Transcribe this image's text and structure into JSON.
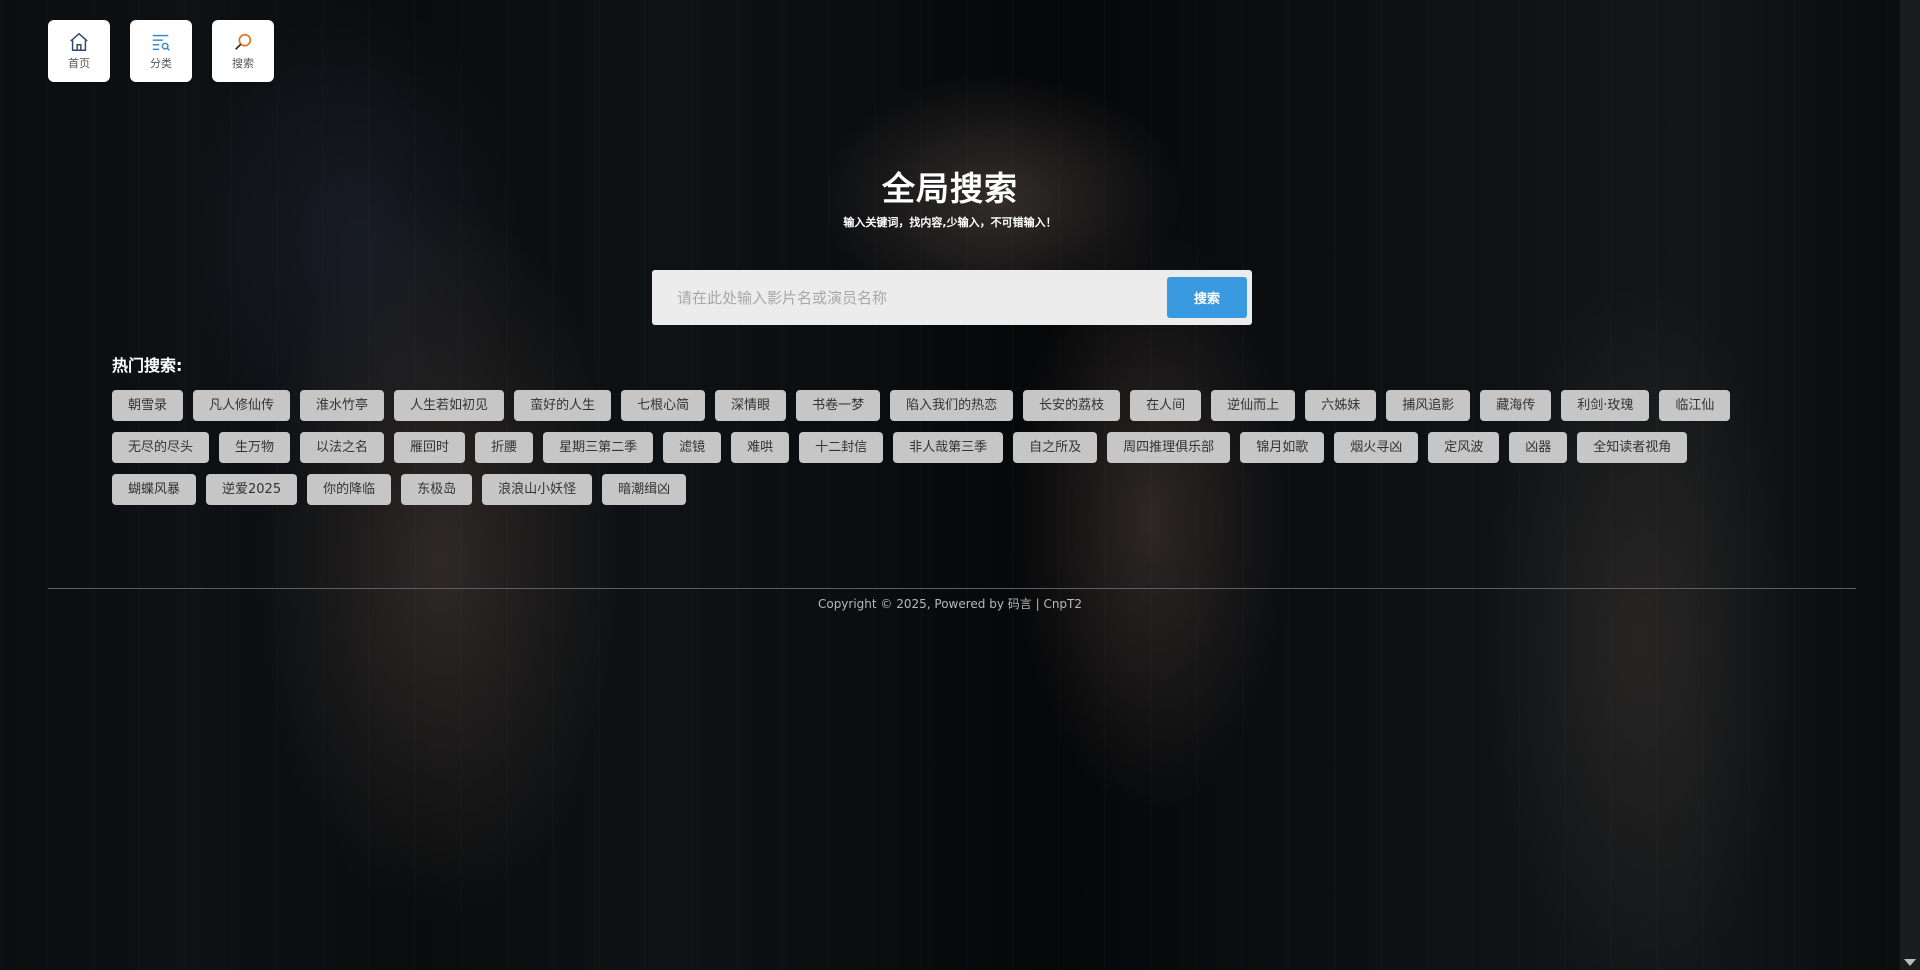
{
  "nav": [
    {
      "label": "首页",
      "icon": "home-icon"
    },
    {
      "label": "分类",
      "icon": "category-icon"
    },
    {
      "label": "搜索",
      "icon": "search-icon"
    }
  ],
  "header": {
    "title": "全局搜索",
    "subtitle": "输入关键词，找内容,少输入，不可错输入！"
  },
  "search": {
    "placeholder": "请在此处输入影片名或演员名称",
    "value": "",
    "button_label": "搜索"
  },
  "hot": {
    "label": "热门搜索:",
    "tags": [
      "朝雪录",
      "凡人修仙传",
      "淮水竹亭",
      "人生若如初见",
      "蛮好的人生",
      "七根心简",
      "深情眼",
      "书卷一梦",
      "陷入我们的热恋",
      "长安的荔枝",
      "在人间",
      "逆仙而上",
      "六姊妹",
      "捕风追影",
      "藏海传",
      "利剑·玫瑰",
      "临江仙",
      "无尽的尽头",
      "生万物",
      "以法之名",
      "雁回时",
      "折腰",
      "星期三第二季",
      "滤镜",
      "难哄",
      "十二封信",
      "非人哉第三季",
      "自之所及",
      "周四推理俱乐部",
      "锦月如歌",
      "烟火寻凶",
      "定风波",
      "凶器",
      "全知读者视角",
      "蝴蝶风暴",
      "逆爱2025",
      "你的降临",
      "东极岛",
      "浪浪山小妖怪",
      "暗潮缉凶"
    ]
  },
  "footer": {
    "copyright": "Copyright © 2025, Powered by 码言 | CnpT2"
  },
  "colors": {
    "accent": "#3a9ae0",
    "tag_bg": "#c6c6c6"
  }
}
